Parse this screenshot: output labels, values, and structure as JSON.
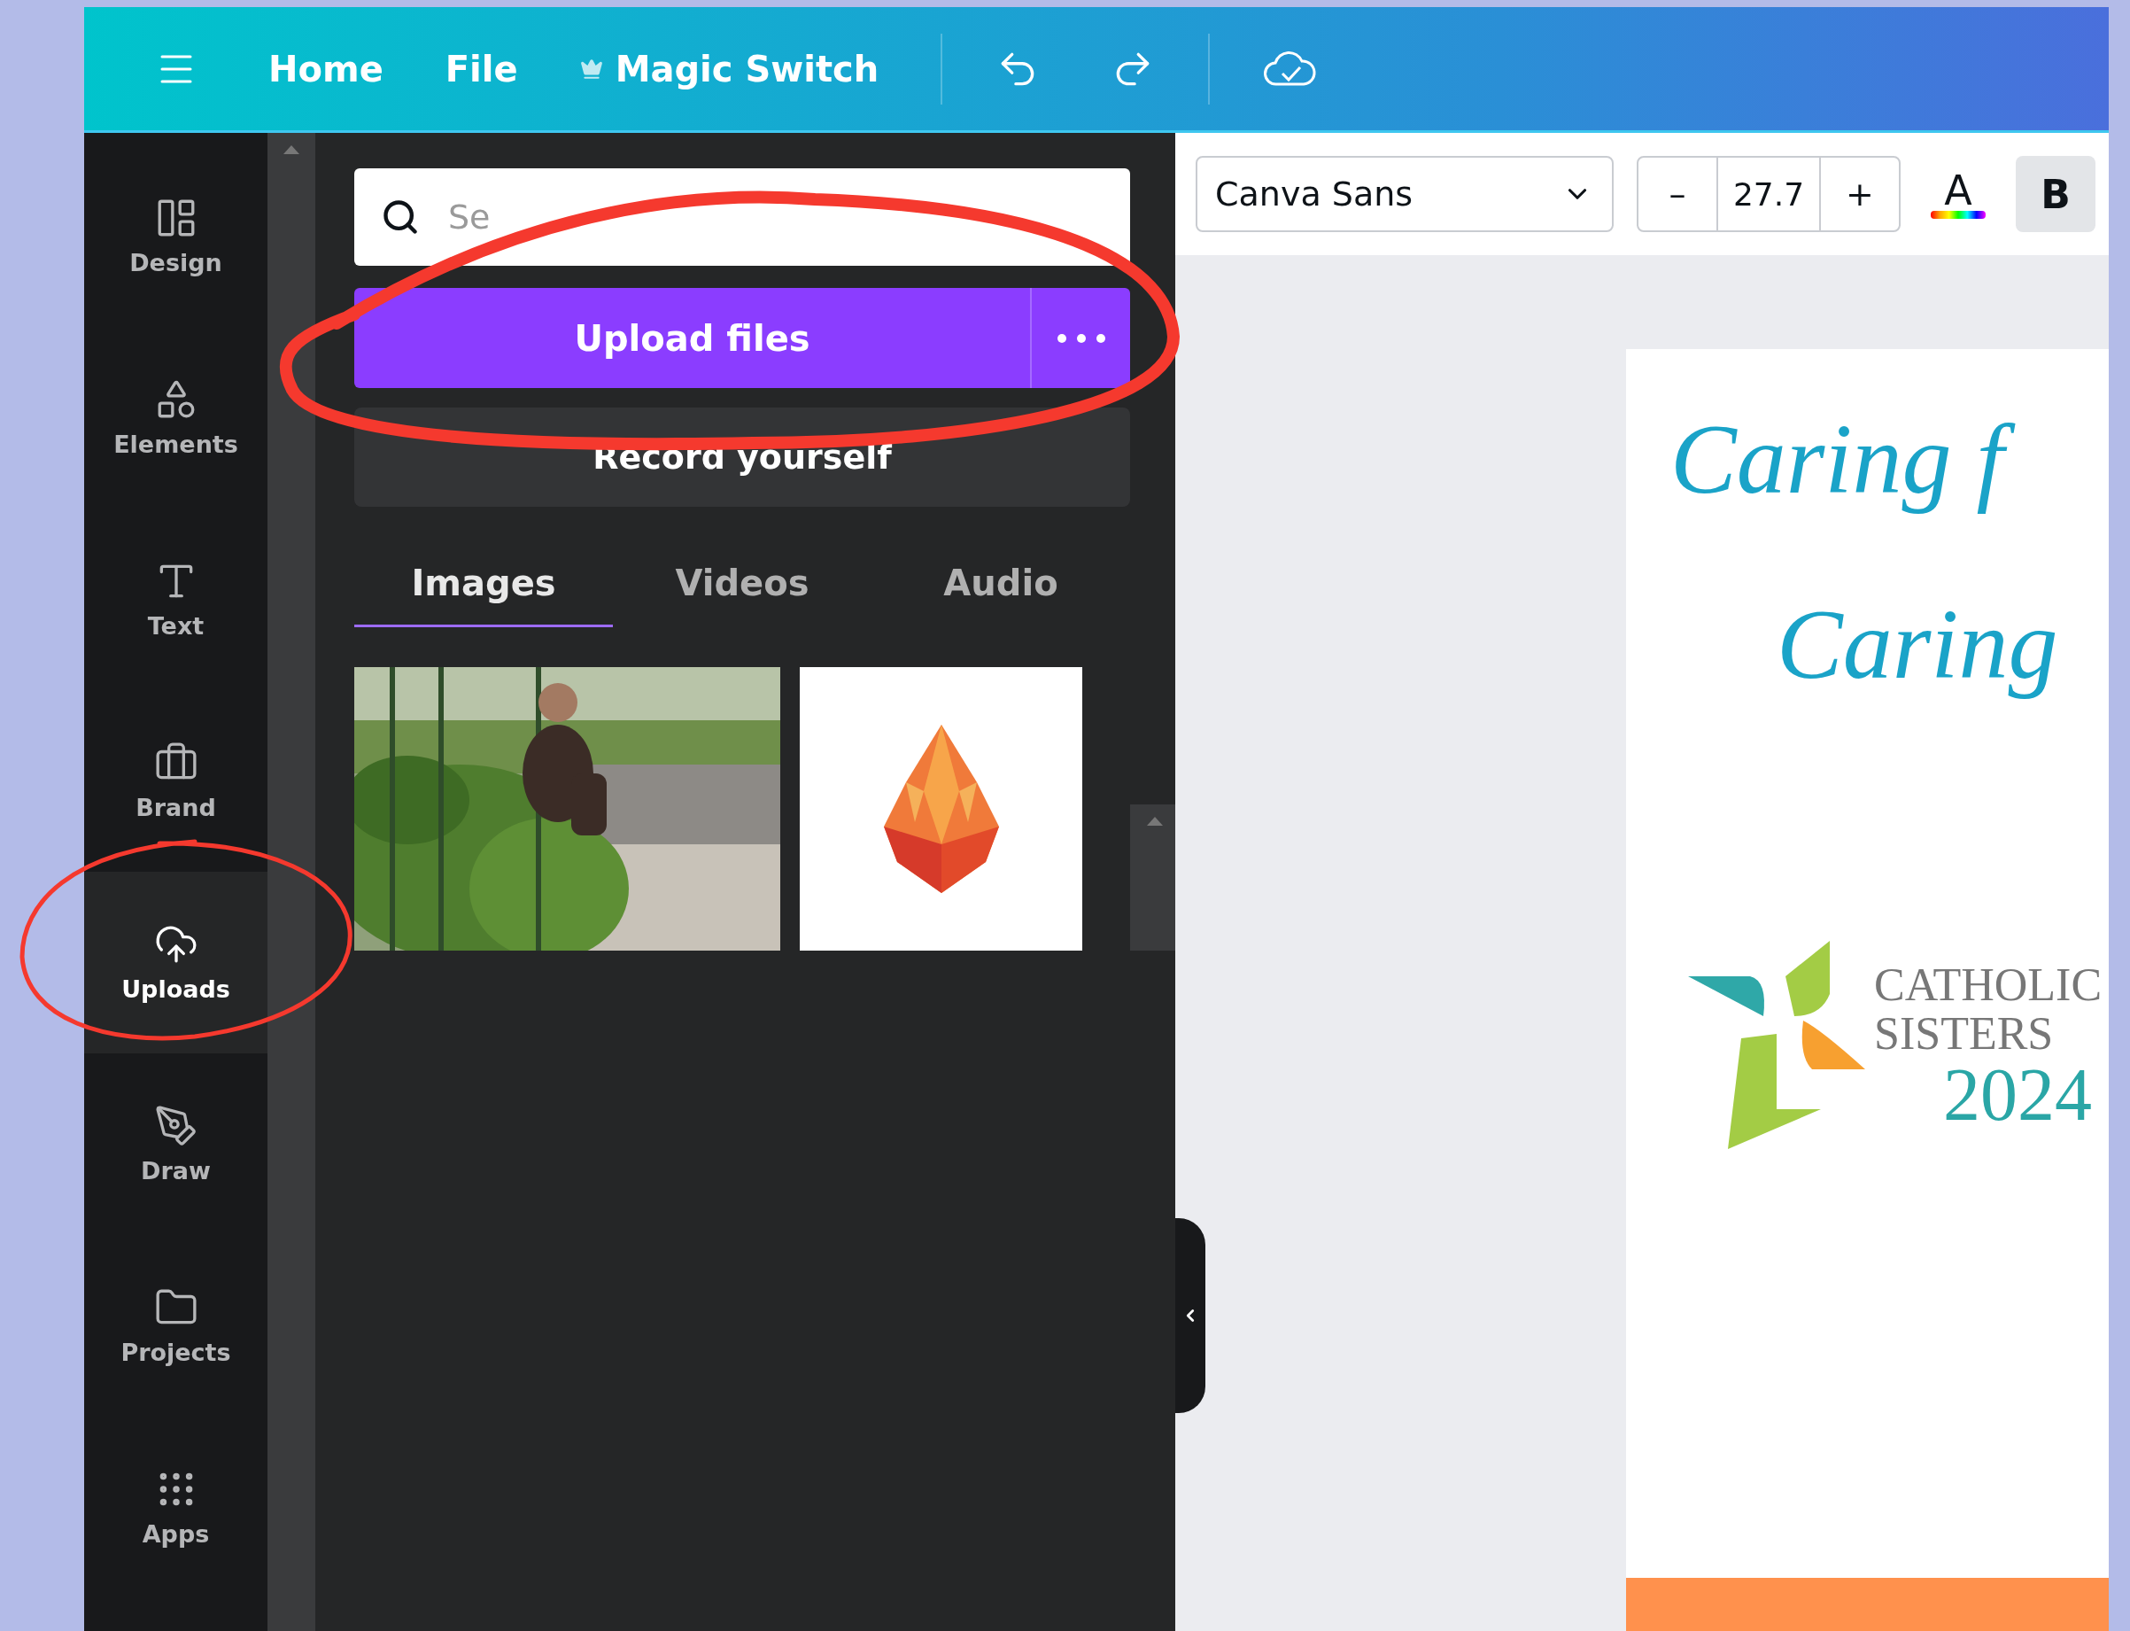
{
  "top_bar": {
    "items": [
      {
        "kind": "plain",
        "label": "Home"
      },
      {
        "kind": "plain",
        "label": "File"
      },
      {
        "kind": "crown",
        "label": "Magic Switch"
      }
    ]
  },
  "sidebar": {
    "items": [
      {
        "kind": "design",
        "label": "Design",
        "selected": false
      },
      {
        "kind": "elements",
        "label": "Elements",
        "selected": false
      },
      {
        "kind": "text",
        "label": "Text",
        "selected": false
      },
      {
        "kind": "brand",
        "label": "Brand",
        "selected": false
      },
      {
        "kind": "uploads",
        "label": "Uploads",
        "selected": true
      },
      {
        "kind": "draw",
        "label": "Draw",
        "selected": false
      },
      {
        "kind": "projects",
        "label": "Projects",
        "selected": false
      },
      {
        "kind": "apps",
        "label": "Apps",
        "selected": false
      }
    ]
  },
  "panel": {
    "search": {
      "placeholder": "Se"
    },
    "upload_button": {
      "label": "Upload files"
    },
    "record_button": {
      "label": "Record yourself"
    },
    "tabs": [
      {
        "label": "Images",
        "selected": true
      },
      {
        "label": "Videos",
        "selected": false
      },
      {
        "label": "Audio",
        "selected": false
      }
    ]
  },
  "toolbar": {
    "font": "Canva Sans",
    "minus": "–",
    "font_size": "27.7",
    "plus": "+",
    "color_glyph": "A",
    "bold_glyph": "B",
    "bold": true
  },
  "canvas": {
    "headings": [
      "Caring f",
      "Caring"
    ],
    "logo_lines": [
      "CATHOLIC",
      "SISTERS"
    ],
    "year": "2024"
  }
}
